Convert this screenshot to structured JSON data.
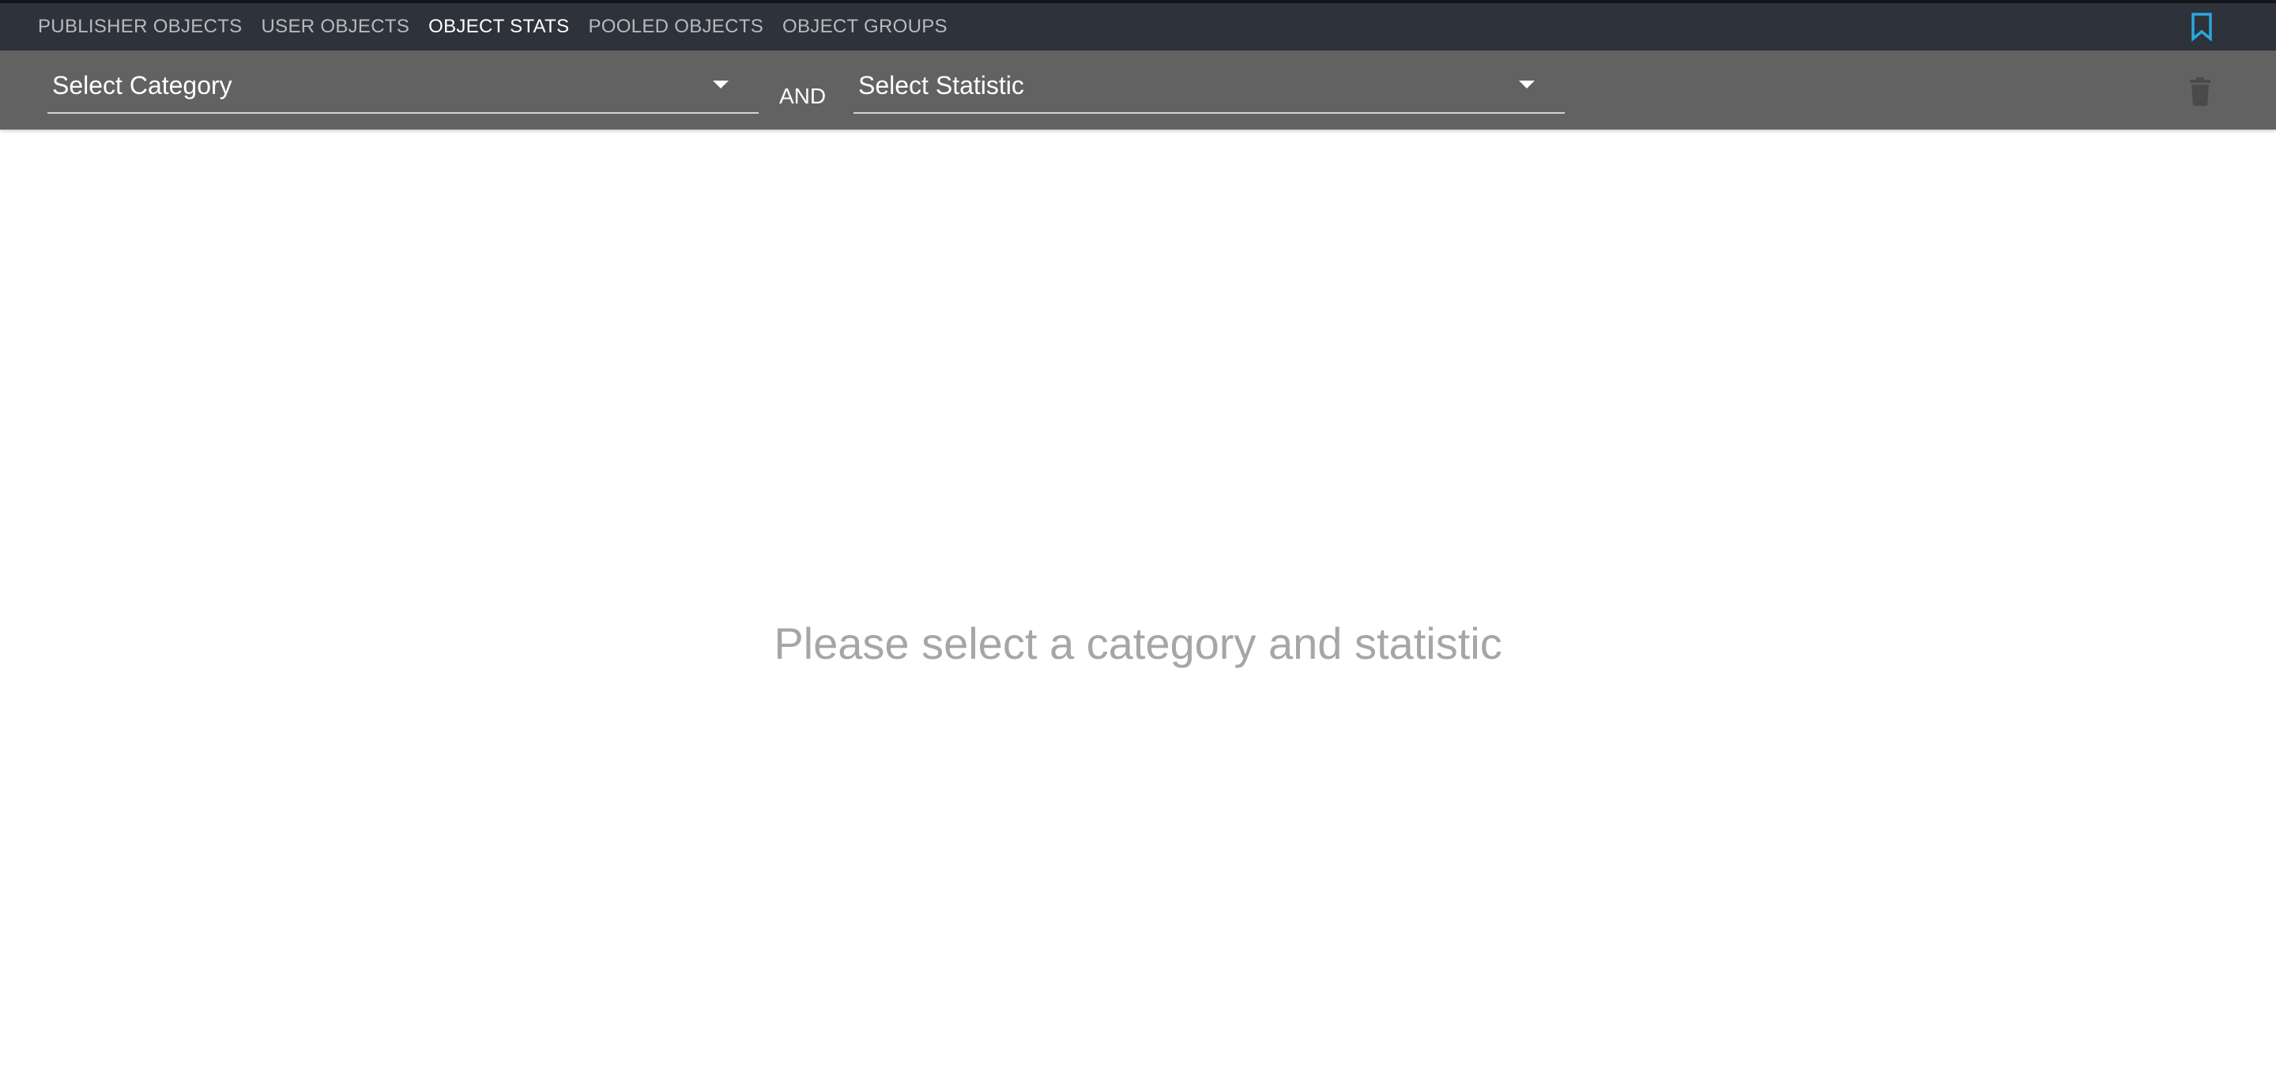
{
  "nav": {
    "tabs": [
      {
        "label": "PUBLISHER OBJECTS",
        "active": false
      },
      {
        "label": "USER OBJECTS",
        "active": false
      },
      {
        "label": "OBJECT STATS",
        "active": true
      },
      {
        "label": "POOLED OBJECTS",
        "active": false
      },
      {
        "label": "OBJECT GROUPS",
        "active": false
      }
    ],
    "bookmark_icon": "bookmark-icon",
    "bookmark_color": "#2aa8e0"
  },
  "filters": {
    "category_placeholder": "Select Category",
    "conjunction": "AND",
    "statistic_placeholder": "Select Statistic",
    "dropdown_icon": "caret-down-icon",
    "delete_icon": "trash-icon"
  },
  "main": {
    "empty_message": "Please select a category and statistic"
  },
  "colors": {
    "topbar": "#2e323a",
    "filterbar": "#626262",
    "tab_inactive": "#b7babe",
    "tab_active": "#ffffff",
    "message": "#a6a6a6"
  }
}
